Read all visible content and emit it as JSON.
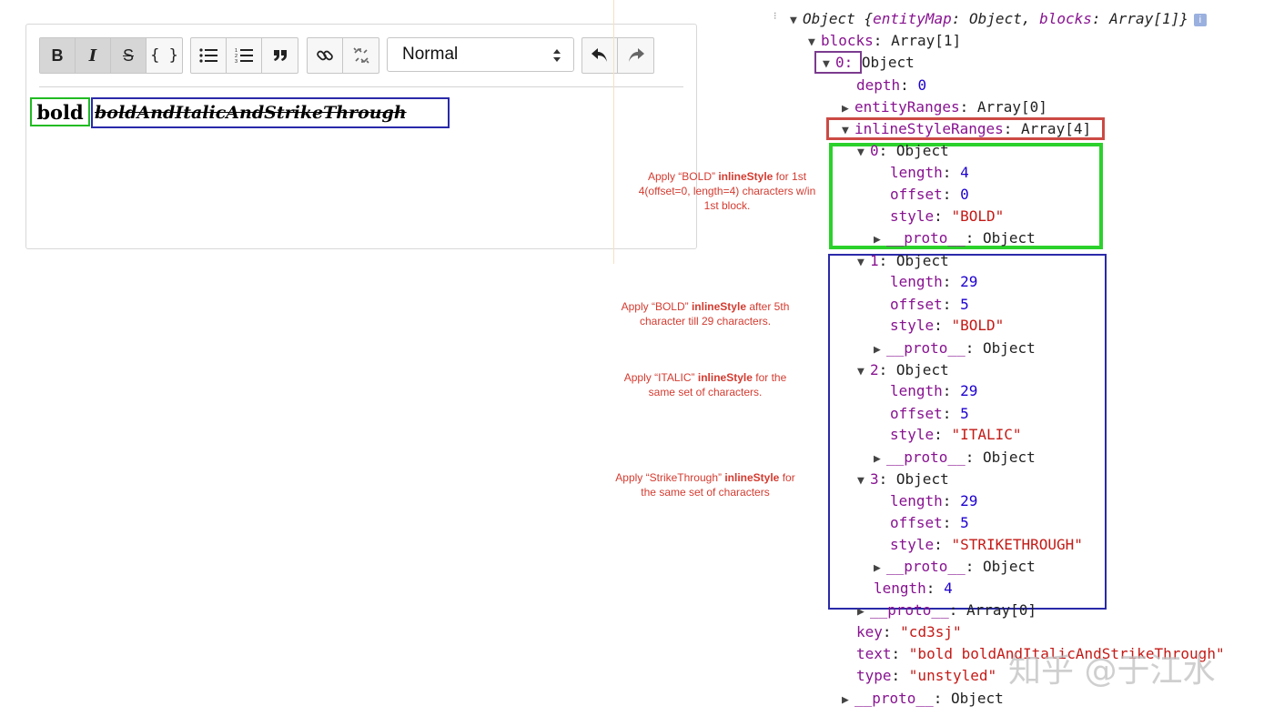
{
  "editor": {
    "toolbar": {
      "bold": "B",
      "italic": "I",
      "strikethrough": "S",
      "code": "{ }",
      "block_type": "Normal"
    },
    "content": {
      "segment1": "bold",
      "segment2": "boldAndItalicAndStrikeThrough"
    }
  },
  "annotations": [
    {
      "pre": "Apply “BOLD” ",
      "bold": "inlineStyle",
      "post": " for 1st 4(offset=0, length=4) characters w/in 1st block."
    },
    {
      "pre": "Apply “BOLD” ",
      "bold": "inlineStyle",
      "post": " after 5th character till 29 characters."
    },
    {
      "pre": "Apply “ITALIC” ",
      "bold": "inlineStyle",
      "post": " for the same set of characters."
    },
    {
      "pre": "Apply “StrikeThrough” ",
      "bold": "inlineStyle",
      "post": " for the same set of characters"
    }
  ],
  "console": {
    "root": {
      "prefix": "Object {",
      "k1": "entityMap",
      "v1": "Object",
      "k2": "blocks",
      "v2": "Array[1]",
      "suffix": "}",
      "info": "i"
    },
    "blocks": {
      "key": "blocks",
      "value": "Array[1]"
    },
    "item0": {
      "key": "0",
      "value": "Object"
    },
    "depth": {
      "key": "depth",
      "value": "0"
    },
    "entityRanges": {
      "key": "entityRanges",
      "value": "Array[0]"
    },
    "inlineStyleRanges": {
      "key": "inlineStyleRanges",
      "value": "Array[4]"
    },
    "ranges": [
      {
        "idx": "0",
        "type": "Object",
        "length": "4",
        "offset": "0",
        "style": "\"BOLD\""
      },
      {
        "idx": "1",
        "type": "Object",
        "length": "29",
        "offset": "5",
        "style": "\"BOLD\""
      },
      {
        "idx": "2",
        "type": "Object",
        "length": "29",
        "offset": "5",
        "style": "\"ITALIC\""
      },
      {
        "idx": "3",
        "type": "Object",
        "length": "29",
        "offset": "5",
        "style": "\"STRIKETHROUGH\""
      }
    ],
    "labels": {
      "length": "length",
      "offset": "offset",
      "style": "style",
      "proto": "__proto__",
      "object": "Object"
    },
    "rangesLength": {
      "key": "length",
      "value": "4"
    },
    "rangesProto": {
      "key": "__proto__",
      "value": "Array[0]"
    },
    "key": {
      "key": "key",
      "value": "\"cd3sj\""
    },
    "text": {
      "key": "text",
      "value": "\"bold boldAndItalicAndStrikeThrough\""
    },
    "type": {
      "key": "type",
      "value": "\"unstyled\""
    },
    "blockProto": {
      "key": "__proto__",
      "value": "Object"
    }
  },
  "watermark": "知乎 @于江水"
}
